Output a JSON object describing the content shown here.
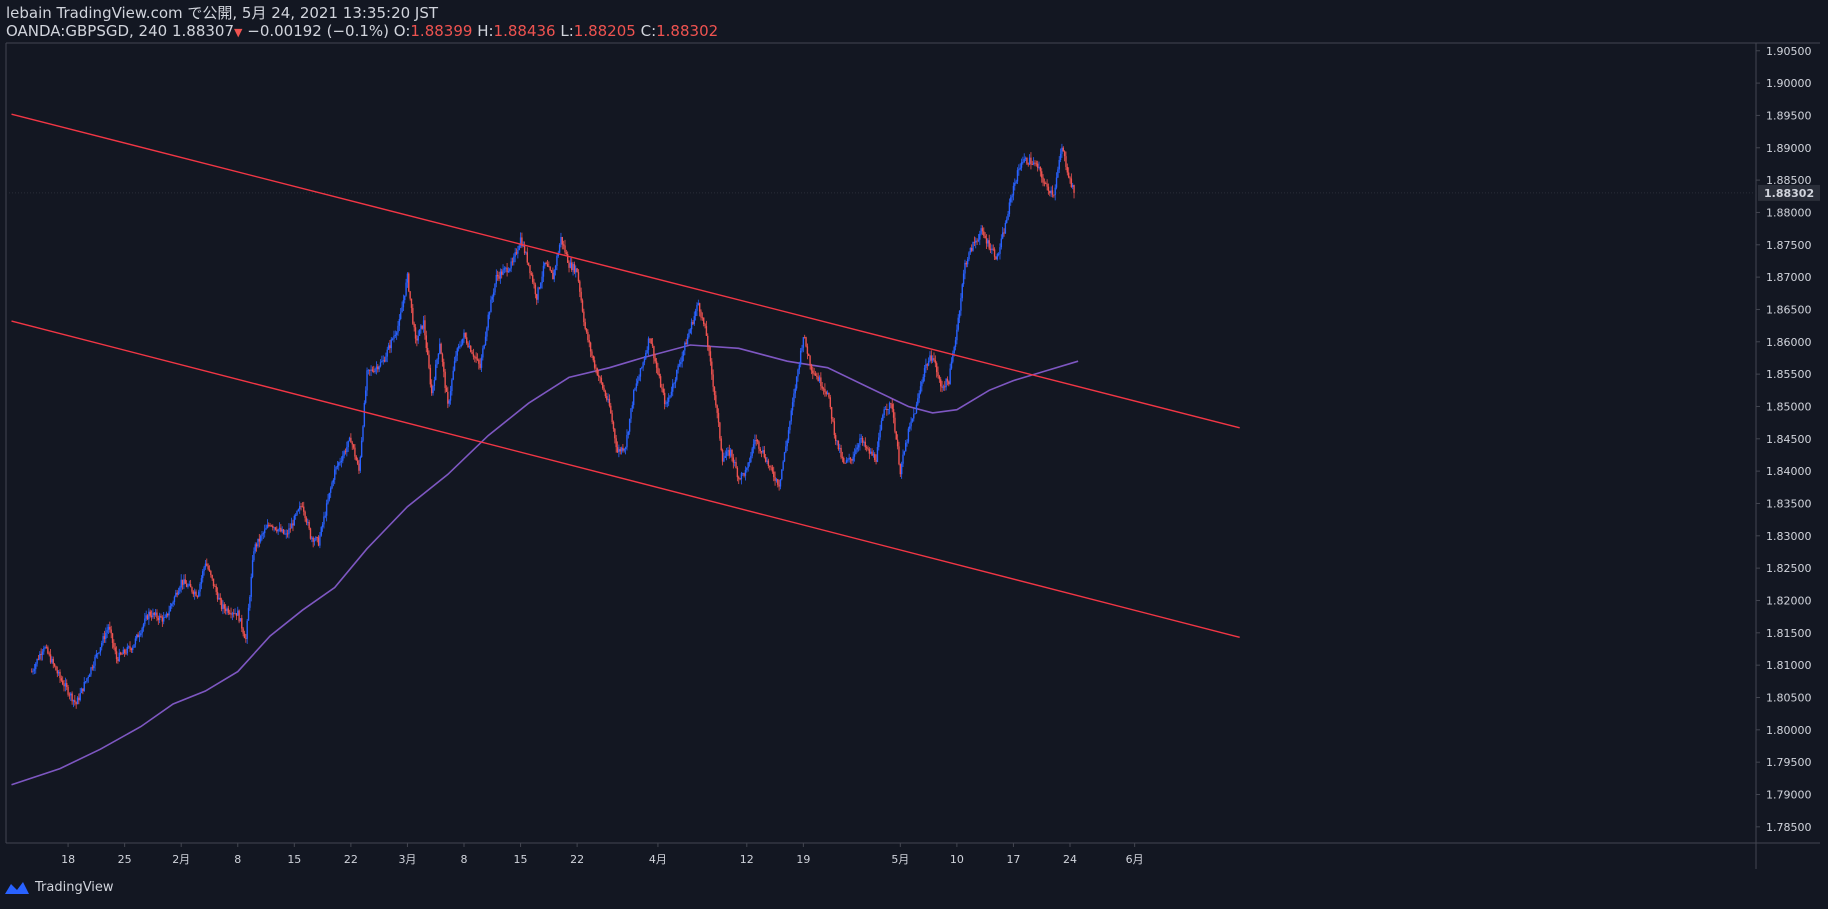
{
  "header": {
    "line1": "lebain TradingView.com で公開, 5月 24, 2021 13:35:20 JST",
    "symbol": "OANDA:GBPSGD, 240",
    "last": "1.88307",
    "change": "−0.00192 (−0.1%)",
    "o_label": "O:",
    "o_value": "1.88399",
    "h_label": "H:",
    "h_value": "1.88436",
    "l_label": "L:",
    "l_value": "1.88205",
    "c_label": "C:",
    "c_value": "1.88302"
  },
  "footer": {
    "brand": "TradingView",
    "logo_icon": "tradingview-logo-icon"
  },
  "colors": {
    "background": "#131722",
    "up": "#2962ff",
    "down": "#ef5350",
    "trendline": "#f23645",
    "ma": "#7e57c2",
    "text": "#d1d4dc",
    "grid_axis": "#434651"
  },
  "chart_data": {
    "type": "candlestick",
    "title": "",
    "xlabel": "",
    "ylabel": "",
    "ylim": [
      1.7825,
      1.9062
    ],
    "y_ticks": [
      "1.90500",
      "1.90000",
      "1.89500",
      "1.89000",
      "1.88500",
      "1.88000",
      "1.87500",
      "1.87000",
      "1.86500",
      "1.86000",
      "1.85500",
      "1.85000",
      "1.84500",
      "1.84000",
      "1.83500",
      "1.83000",
      "1.82500",
      "1.82000",
      "1.81500",
      "1.81000",
      "1.80500",
      "1.80000",
      "1.79500",
      "1.79000",
      "1.78500"
    ],
    "current_price_label": "1.88302",
    "current_price": 1.88302,
    "x_ticks": [
      {
        "label": "18",
        "day": 1
      },
      {
        "label": "25",
        "day": 8
      },
      {
        "label": "2月",
        "day": 15
      },
      {
        "label": "8",
        "day": 22
      },
      {
        "label": "15",
        "day": 29
      },
      {
        "label": "22",
        "day": 36
      },
      {
        "label": "3月",
        "day": 43
      },
      {
        "label": "8",
        "day": 50
      },
      {
        "label": "15",
        "day": 57
      },
      {
        "label": "22",
        "day": 64
      },
      {
        "label": "4月",
        "day": 74
      },
      {
        "label": "12",
        "day": 85
      },
      {
        "label": "19",
        "day": 92
      },
      {
        "label": "5月",
        "day": 104
      },
      {
        "label": "10",
        "day": 111
      },
      {
        "label": "17",
        "day": 118
      },
      {
        "label": "24",
        "day": 125
      },
      {
        "label": "6月",
        "day": 133
      }
    ],
    "price_path": [
      [
        -3.5,
        1.809
      ],
      [
        -2,
        1.813
      ],
      [
        0,
        1.808
      ],
      [
        2,
        1.804
      ],
      [
        4,
        1.81
      ],
      [
        6,
        1.816
      ],
      [
        7,
        1.811
      ],
      [
        9,
        1.813
      ],
      [
        11,
        1.818
      ],
      [
        13,
        1.817
      ],
      [
        15,
        1.823
      ],
      [
        17,
        1.821
      ],
      [
        18,
        1.826
      ],
      [
        20,
        1.819
      ],
      [
        22,
        1.818
      ],
      [
        23,
        1.814
      ],
      [
        24,
        1.828
      ],
      [
        26,
        1.832
      ],
      [
        28,
        1.83
      ],
      [
        30,
        1.835
      ],
      [
        31,
        1.83
      ],
      [
        32,
        1.829
      ],
      [
        34,
        1.84
      ],
      [
        36,
        1.845
      ],
      [
        37,
        1.84
      ],
      [
        38,
        1.855
      ],
      [
        40,
        1.857
      ],
      [
        42,
        1.863
      ],
      [
        43,
        1.87
      ],
      [
        44,
        1.86
      ],
      [
        45,
        1.863
      ],
      [
        46,
        1.852
      ],
      [
        47,
        1.86
      ],
      [
        48,
        1.85
      ],
      [
        49,
        1.858
      ],
      [
        50,
        1.861
      ],
      [
        52,
        1.856
      ],
      [
        53,
        1.864
      ],
      [
        54,
        1.87
      ],
      [
        56,
        1.872
      ],
      [
        57,
        1.876
      ],
      [
        58,
        1.872
      ],
      [
        59,
        1.867
      ],
      [
        60,
        1.872
      ],
      [
        61,
        1.87
      ],
      [
        62,
        1.876
      ],
      [
        63,
        1.872
      ],
      [
        64,
        1.871
      ],
      [
        65,
        1.862
      ],
      [
        66,
        1.857
      ],
      [
        68,
        1.85
      ],
      [
        69,
        1.843
      ],
      [
        70,
        1.844
      ],
      [
        71,
        1.852
      ],
      [
        72,
        1.856
      ],
      [
        73,
        1.861
      ],
      [
        74,
        1.855
      ],
      [
        75,
        1.85
      ],
      [
        76,
        1.854
      ],
      [
        77,
        1.858
      ],
      [
        78,
        1.862
      ],
      [
        79,
        1.866
      ],
      [
        80,
        1.861
      ],
      [
        81,
        1.852
      ],
      [
        82,
        1.842
      ],
      [
        83,
        1.843
      ],
      [
        84,
        1.839
      ],
      [
        85,
        1.84
      ],
      [
        86,
        1.845
      ],
      [
        87,
        1.843
      ],
      [
        88,
        1.84
      ],
      [
        89,
        1.838
      ],
      [
        90,
        1.845
      ],
      [
        91,
        1.853
      ],
      [
        92,
        1.861
      ],
      [
        93,
        1.856
      ],
      [
        95,
        1.852
      ],
      [
        96,
        1.845
      ],
      [
        97,
        1.841
      ],
      [
        98,
        1.842
      ],
      [
        99,
        1.845
      ],
      [
        100,
        1.843
      ],
      [
        101,
        1.842
      ],
      [
        102,
        1.85
      ],
      [
        103,
        1.85
      ],
      [
        104,
        1.84
      ],
      [
        105,
        1.846
      ],
      [
        106,
        1.85
      ],
      [
        107,
        1.856
      ],
      [
        108,
        1.858
      ],
      [
        109,
        1.853
      ],
      [
        110,
        1.854
      ],
      [
        111,
        1.862
      ],
      [
        112,
        1.872
      ],
      [
        113,
        1.875
      ],
      [
        114,
        1.877
      ],
      [
        115,
        1.875
      ],
      [
        116,
        1.873
      ],
      [
        117,
        1.878
      ],
      [
        118,
        1.884
      ],
      [
        119,
        1.888
      ],
      [
        120,
        1.888
      ],
      [
        121,
        1.887
      ],
      [
        122,
        1.884
      ],
      [
        123,
        1.883
      ],
      [
        124,
        1.89
      ],
      [
        125,
        1.885
      ],
      [
        125.5,
        1.883
      ]
    ],
    "ma": [
      [
        -6,
        1.7915
      ],
      [
        0,
        1.794
      ],
      [
        5,
        1.797
      ],
      [
        10,
        1.8005
      ],
      [
        14,
        1.804
      ],
      [
        18,
        1.806
      ],
      [
        22,
        1.809
      ],
      [
        26,
        1.8145
      ],
      [
        30,
        1.8185
      ],
      [
        34,
        1.822
      ],
      [
        38,
        1.828
      ],
      [
        43,
        1.8345
      ],
      [
        48,
        1.8395
      ],
      [
        53,
        1.8455
      ],
      [
        58,
        1.8505
      ],
      [
        63,
        1.8545
      ],
      [
        68,
        1.856
      ],
      [
        72,
        1.8575
      ],
      [
        78,
        1.8595
      ],
      [
        84,
        1.859
      ],
      [
        90,
        1.857
      ],
      [
        95,
        1.856
      ],
      [
        100,
        1.853
      ],
      [
        105,
        1.85
      ],
      [
        108,
        1.849
      ],
      [
        111,
        1.8495
      ],
      [
        115,
        1.8525
      ],
      [
        118,
        1.854
      ],
      [
        122,
        1.8555
      ],
      [
        126,
        1.857
      ]
    ],
    "trendlines": [
      {
        "name": "upper",
        "x1": -6,
        "y1": 1.8952,
        "x2": 146,
        "y2": 1.8467
      },
      {
        "name": "lower",
        "x1": -6,
        "y1": 1.8632,
        "x2": 146,
        "y2": 1.8143
      }
    ]
  }
}
